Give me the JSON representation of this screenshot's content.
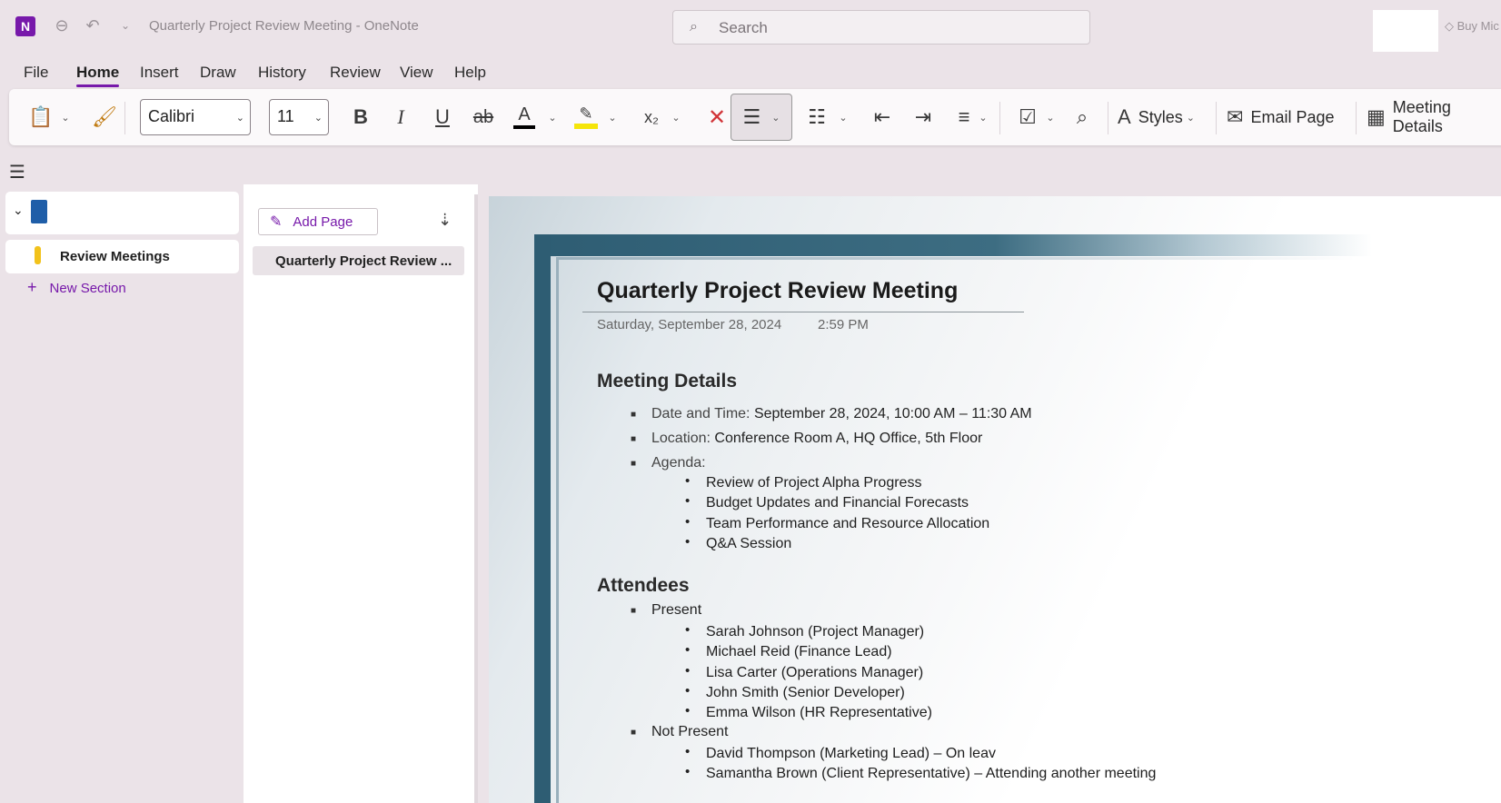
{
  "titlebar": {
    "app_letter": "N",
    "doc_title": "Quarterly Project Review Meeting  -  OneNote",
    "search_placeholder": "Search",
    "buy_label": "Buy Mic"
  },
  "menu": {
    "tabs": [
      "File",
      "Home",
      "Insert",
      "Draw",
      "History",
      "Review",
      "View",
      "Help"
    ],
    "active": "Home"
  },
  "ribbon": {
    "font_name": "Calibri",
    "font_size": "11",
    "bold": "B",
    "italic": "I",
    "underline": "U",
    "strike": "ab",
    "font_color_letter": "A",
    "subscript": "x₂",
    "styles_label": "Styles",
    "email_label": "Email Page",
    "meeting_label": "Meeting Details",
    "font_color": "#000000",
    "highlight_color": "#f5e50a"
  },
  "sidebar": {
    "section_label": "Review Meetings",
    "new_section_label": "New Section",
    "section_color": "#f2c21b"
  },
  "pagelist": {
    "add_page_label": "Add Page",
    "pages": [
      "Quarterly Project Review ..."
    ]
  },
  "page": {
    "title": "Quarterly Project Review Meeting",
    "date": "Saturday, September 28, 2024",
    "time": "2:59 PM",
    "meeting_heading": "Meeting Details",
    "date_time_key": "Date and Time:",
    "date_time_val": " September 28, 2024, 10:00 AM – 11:30 AM",
    "location_key": "Location:",
    "location_val": " Conference Room A, HQ Office, 5th Floor",
    "agenda_key": "Agenda:",
    "agenda": [
      "Review of Project Alpha Progress",
      "Budget Updates and Financial Forecasts",
      "Team Performance and Resource Allocation",
      "Q&A Session"
    ],
    "attendees_heading": "Attendees",
    "present_label": "Present",
    "present": [
      "Sarah Johnson (Project Manager)",
      "Michael Reid (Finance Lead)",
      "Lisa Carter (Operations Manager)",
      "John Smith (Senior Developer)",
      "Emma Wilson (HR Representative)"
    ],
    "not_present_label": "Not Present",
    "not_present": [
      "David Thompson (Marketing Lead) – On leav",
      "Samantha Brown (Client Representative) – Attending another meeting"
    ]
  }
}
